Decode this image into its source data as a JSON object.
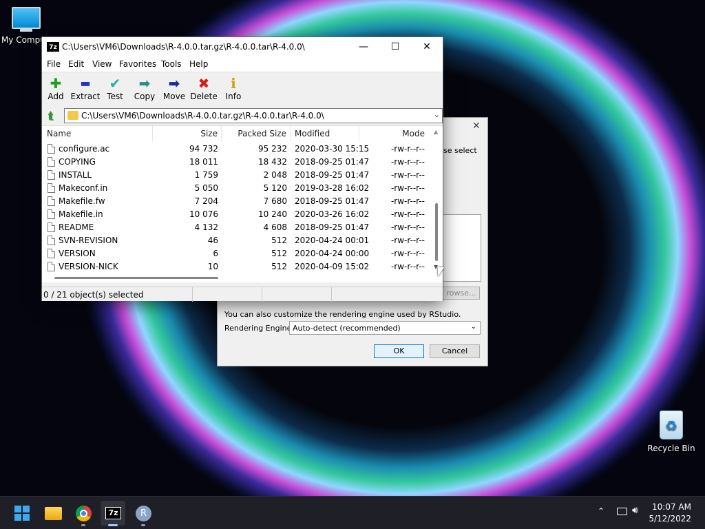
{
  "desktop": {
    "my_computer_label": "My Compu",
    "recycle_bin_label": "Recycle Bin"
  },
  "rstudio_dialog": {
    "partial_text": "se select",
    "browse_label": "rowse...",
    "customize_text": "You can also customize the rendering engine used by RStudio.",
    "engine_label": "Rendering Engine:",
    "engine_value": "Auto-detect (recommended)",
    "ok_label": "OK",
    "cancel_label": "Cancel"
  },
  "window": {
    "app_badge": "7z",
    "title": "C:\\Users\\VM6\\Downloads\\R-4.0.0.tar.gz\\R-4.0.0.tar\\R-4.0.0\\",
    "minimize": "—",
    "maximize": "☐",
    "close": "✕"
  },
  "menu": [
    "File",
    "Edit",
    "View",
    "Favorites",
    "Tools",
    "Help"
  ],
  "toolbar": [
    {
      "label": "Add",
      "icon": "plus-icon",
      "glyph": "✚",
      "color": "#1aa31a"
    },
    {
      "label": "Extract",
      "icon": "minus-icon",
      "glyph": "▬",
      "color": "#1e35c8"
    },
    {
      "label": "Test",
      "icon": "check-icon",
      "glyph": "✔",
      "color": "#20b0a8"
    },
    {
      "label": "Copy",
      "icon": "copy-arrow-icon",
      "glyph": "➡",
      "color": "#2c8c88"
    },
    {
      "label": "Move",
      "icon": "move-arrow-icon",
      "glyph": "➡",
      "color": "#1a2a9a"
    },
    {
      "label": "Delete",
      "icon": "delete-x-icon",
      "glyph": "✖",
      "color": "#d41a1a"
    },
    {
      "label": "Info",
      "icon": "info-icon",
      "glyph": "ℹ",
      "color": "#c8a400"
    }
  ],
  "address": {
    "path": "C:\\Users\\VM6\\Downloads\\R-4.0.0.tar.gz\\R-4.0.0.tar\\R-4.0.0\\"
  },
  "columns": {
    "name": "Name",
    "size": "Size",
    "packed": "Packed Size",
    "modified": "Modified",
    "mode": "Mode"
  },
  "files": [
    {
      "name": "configure.ac",
      "size": "94 732",
      "packed": "95 232",
      "modified": "2020-03-30 15:15",
      "mode": "-rw-r--r--"
    },
    {
      "name": "COPYING",
      "size": "18 011",
      "packed": "18 432",
      "modified": "2018-09-25 01:47",
      "mode": "-rw-r--r--"
    },
    {
      "name": "INSTALL",
      "size": "1 759",
      "packed": "2 048",
      "modified": "2018-09-25 01:47",
      "mode": "-rw-r--r--"
    },
    {
      "name": "Makeconf.in",
      "size": "5 050",
      "packed": "5 120",
      "modified": "2019-03-28 16:02",
      "mode": "-rw-r--r--"
    },
    {
      "name": "Makefile.fw",
      "size": "7 204",
      "packed": "7 680",
      "modified": "2018-09-25 01:47",
      "mode": "-rw-r--r--"
    },
    {
      "name": "Makefile.in",
      "size": "10 076",
      "packed": "10 240",
      "modified": "2020-03-26 16:02",
      "mode": "-rw-r--r--"
    },
    {
      "name": "README",
      "size": "4 132",
      "packed": "4 608",
      "modified": "2018-09-25 01:47",
      "mode": "-rw-r--r--"
    },
    {
      "name": "SVN-REVISION",
      "size": "46",
      "packed": "512",
      "modified": "2020-04-24 00:01",
      "mode": "-rw-r--r--"
    },
    {
      "name": "VERSION",
      "size": "6",
      "packed": "512",
      "modified": "2020-04-24 00:00",
      "mode": "-rw-r--r--"
    },
    {
      "name": "VERSION-NICK",
      "size": "10",
      "packed": "512",
      "modified": "2020-04-09 15:02",
      "mode": "-rw-r--r--"
    }
  ],
  "status": {
    "selection": "0 / 21 object(s) selected"
  },
  "taskbar": {
    "time": "10:07 AM",
    "date": "5/12/2022",
    "zip_badge": "7z",
    "r_badge": "R"
  }
}
